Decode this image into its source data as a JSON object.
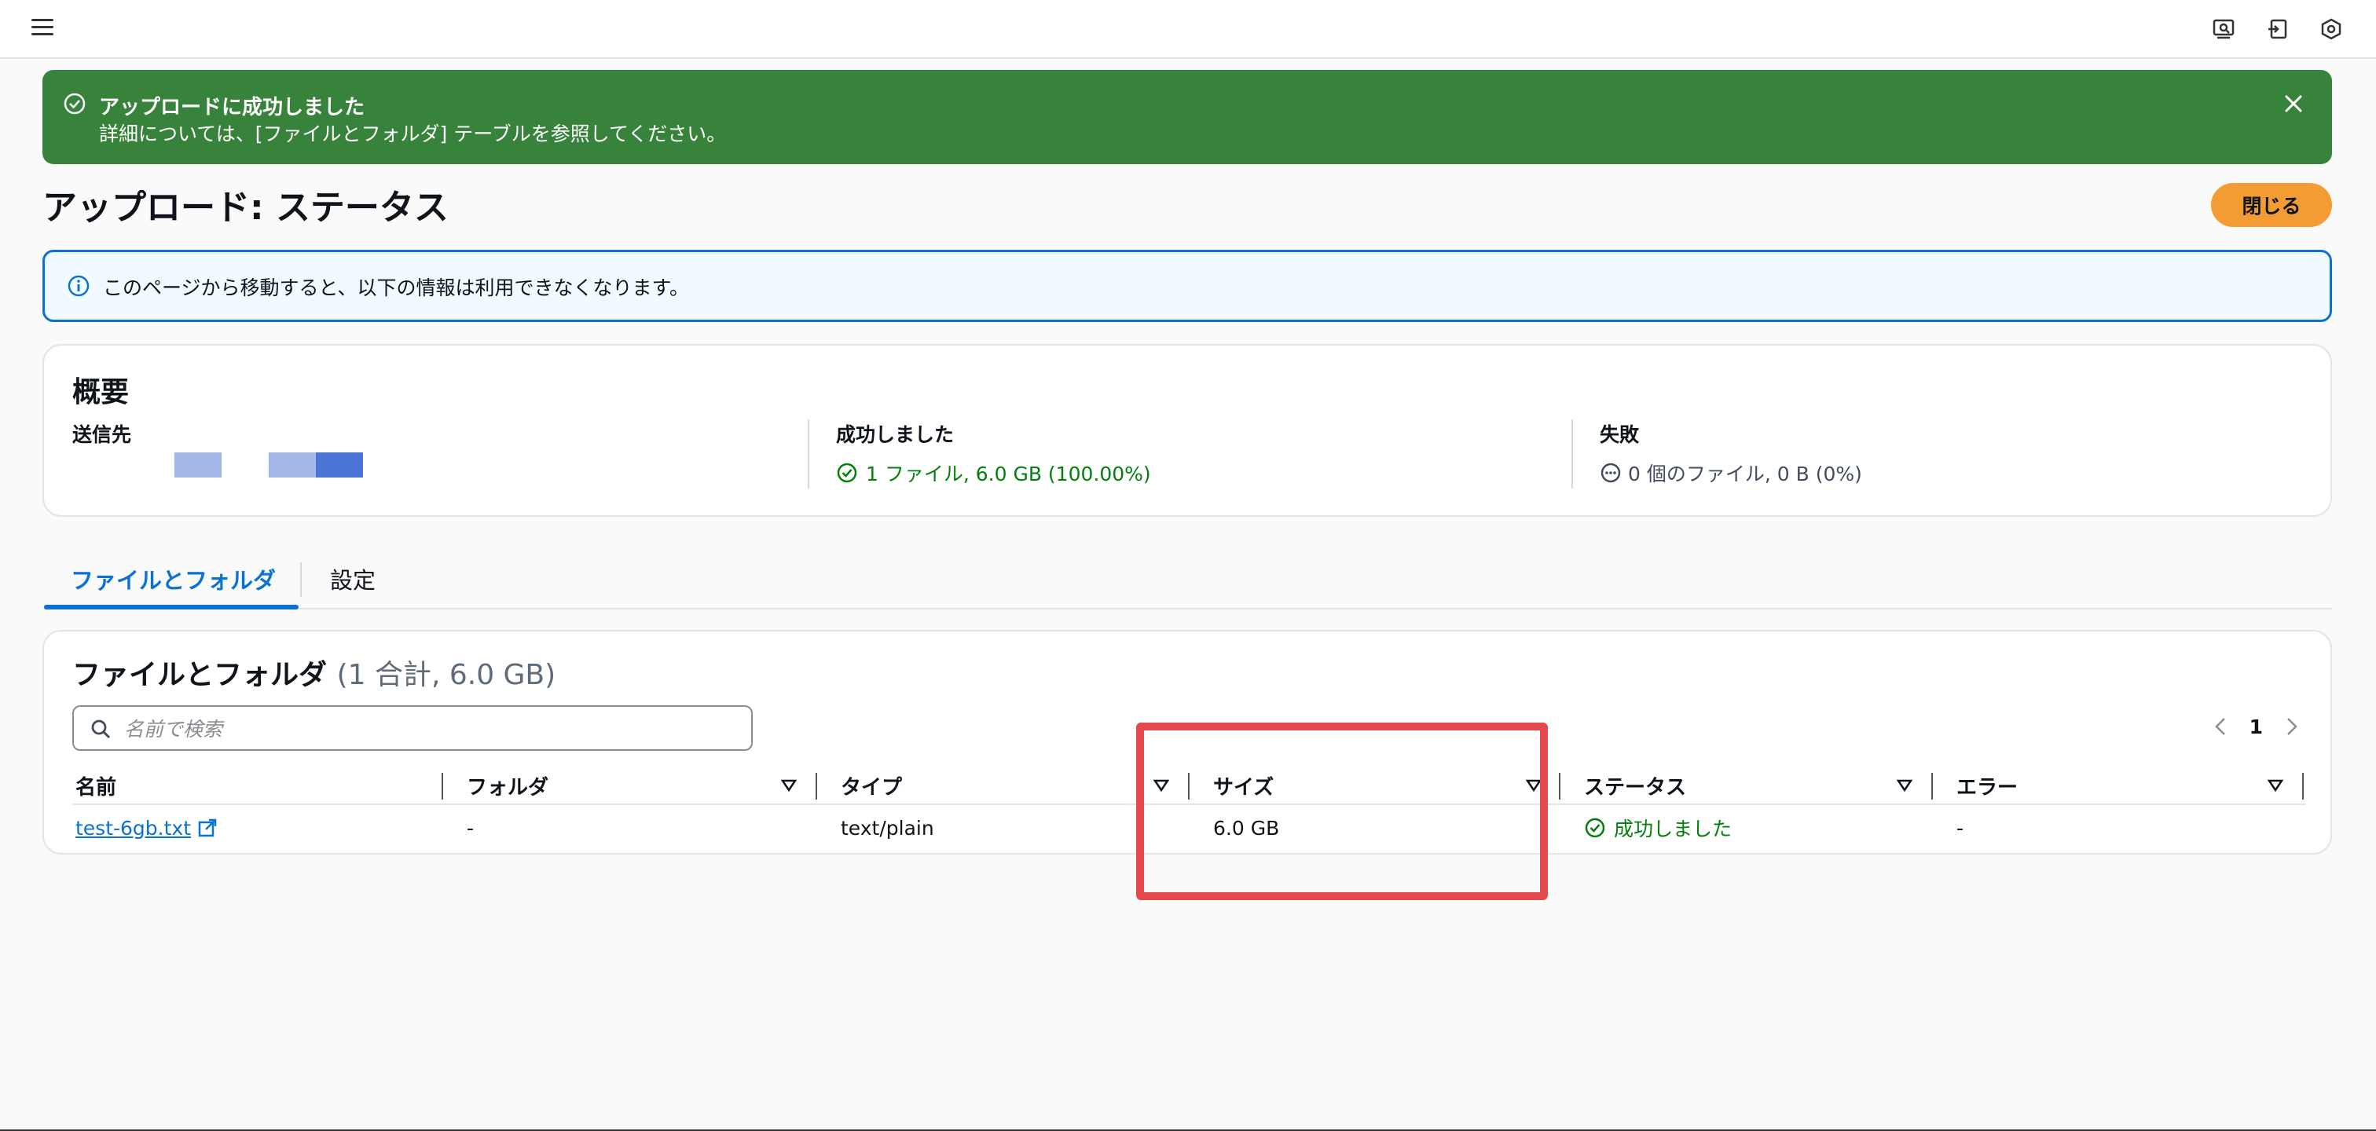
{
  "flash": {
    "title": "アップロードに成功しました",
    "description": "詳細については、[ファイルとフォルダ] テーブルを参照してください。"
  },
  "header": {
    "title": "アップロード: ステータス",
    "close_label": "閉じる"
  },
  "info": {
    "text": "このページから移動すると、以下の情報は利用できなくなります。"
  },
  "summary": {
    "title": "概要",
    "destination_label": "送信先",
    "succeeded_label": "成功しました",
    "succeeded_value": "1 ファイル, 6.0 GB (100.00%)",
    "failed_label": "失敗",
    "failed_value": "0 個のファイル, 0 B (0%)"
  },
  "tabs": [
    {
      "label": "ファイルとフォルダ",
      "active": true
    },
    {
      "label": "設定",
      "active": false
    }
  ],
  "files": {
    "title": "ファイルとフォルダ",
    "count": "(1 合計, 6.0 GB)",
    "search_placeholder": "名前で検索",
    "page": "1",
    "columns": [
      "名前",
      "フォルダ",
      "タイプ",
      "サイズ",
      "ステータス",
      "エラー"
    ],
    "rows": [
      {
        "name": "test-6gb.txt",
        "folder": "-",
        "type": "text/plain",
        "size": "6.0 GB",
        "status": "成功しました",
        "error": "-"
      }
    ]
  },
  "colors": {
    "success_banner": "#37833b",
    "primary_button": "#f49c34",
    "link": "#0972d3",
    "success_text": "#037f0c",
    "highlight": "#e5484d"
  },
  "icons": [
    "menu-icon",
    "search-preview-icon",
    "export-icon",
    "settings-hex-icon",
    "check-circle-icon",
    "close-icon",
    "info-icon",
    "ellipsis-circle-icon",
    "search-icon",
    "chevron-left-icon",
    "chevron-right-icon",
    "sort-down-icon",
    "external-link-icon"
  ]
}
